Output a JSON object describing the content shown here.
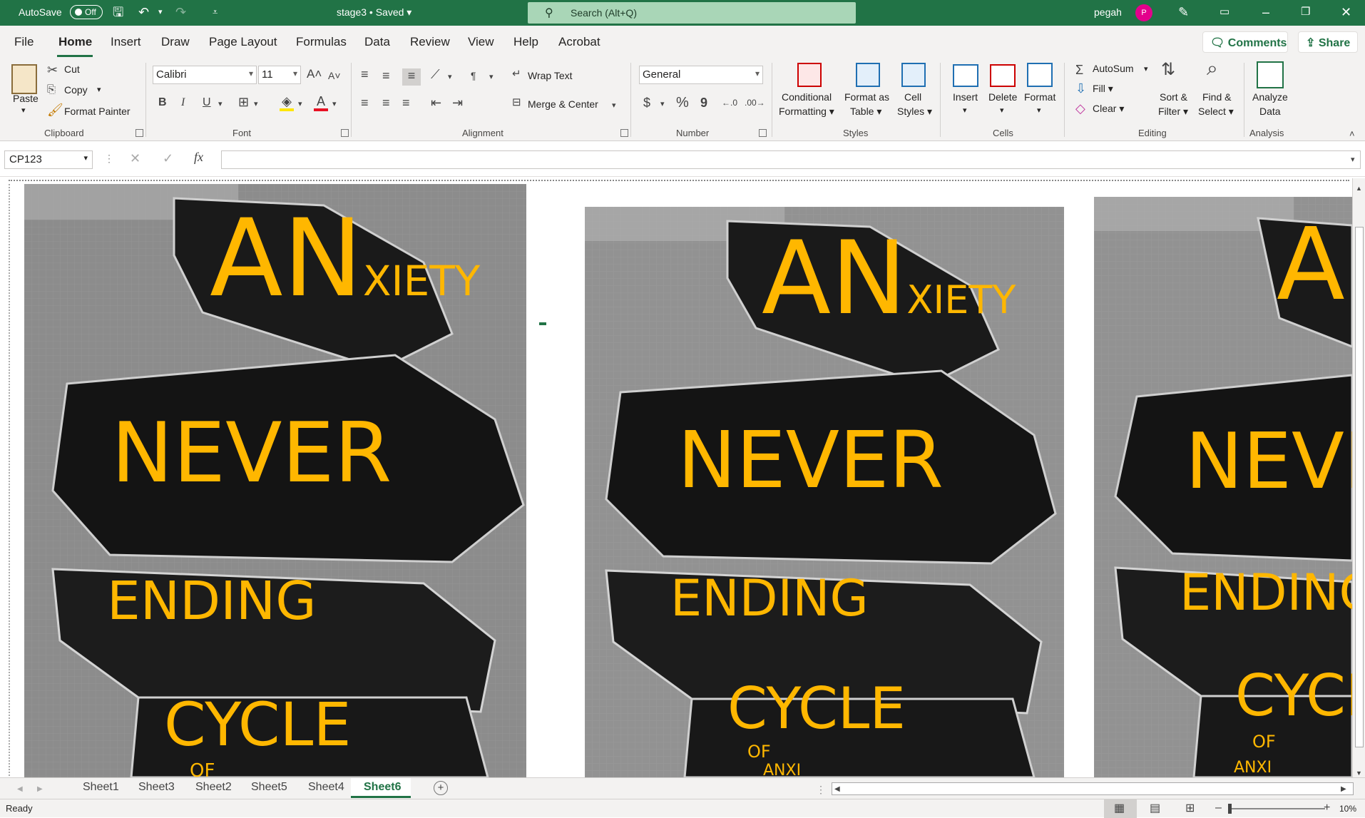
{
  "titlebar": {
    "autosave_label": "AutoSave",
    "autosave_state": "Off",
    "document_title": "stage3 • Saved",
    "search_placeholder": "Search (Alt+Q)",
    "user_name": "pegah",
    "user_initial": "P"
  },
  "menu": {
    "items": [
      "File",
      "Home",
      "Insert",
      "Draw",
      "Page Layout",
      "Formulas",
      "Data",
      "Review",
      "View",
      "Help",
      "Acrobat"
    ],
    "active": "Home",
    "comments_label": "Comments",
    "share_label": "Share"
  },
  "ribbon": {
    "clipboard": {
      "paste": "Paste",
      "cut": "Cut",
      "copy": "Copy",
      "format_painter": "Format Painter",
      "group": "Clipboard"
    },
    "font": {
      "name": "Calibri",
      "size": "11",
      "group": "Font",
      "bold": "B",
      "italic": "I",
      "underline": "U"
    },
    "alignment": {
      "wrap_text": "Wrap Text",
      "merge_center": "Merge & Center",
      "group": "Alignment"
    },
    "number": {
      "format": "General",
      "group": "Number",
      "currency": "$",
      "percent": "%",
      "comma": "9"
    },
    "styles": {
      "conditional_1": "Conditional",
      "conditional_2": "Formatting",
      "format_table_1": "Format as",
      "format_table_2": "Table",
      "cell_styles_1": "Cell",
      "cell_styles_2": "Styles",
      "group": "Styles"
    },
    "cells": {
      "insert": "Insert",
      "delete": "Delete",
      "format": "Format",
      "group": "Cells"
    },
    "editing": {
      "autosum": "AutoSum",
      "fill": "Fill",
      "clear": "Clear",
      "sort_1": "Sort &",
      "sort_2": "Filter",
      "find_1": "Find &",
      "find_2": "Select",
      "group": "Editing"
    },
    "analysis": {
      "analyze_1": "Analyze",
      "analyze_2": "Data",
      "group": "Analysis"
    }
  },
  "formula_bar": {
    "name_box": "CP123",
    "fx": "fx",
    "value": ""
  },
  "poster": {
    "line1_big": "AN",
    "line1_small": "XIETY",
    "line2": "NEVER",
    "line3": "ENDING",
    "line4": "CYCLE",
    "line5": "OF",
    "line6": "ANXI",
    "text_color": "#ffb700",
    "shape_color": "#1a1a1a"
  },
  "sheets": {
    "tabs": [
      "Sheet1",
      "Sheet3",
      "Sheet2",
      "Sheet5",
      "Sheet4",
      "Sheet6"
    ],
    "active": "Sheet6"
  },
  "status": {
    "text": "Ready",
    "zoom": "10%"
  }
}
